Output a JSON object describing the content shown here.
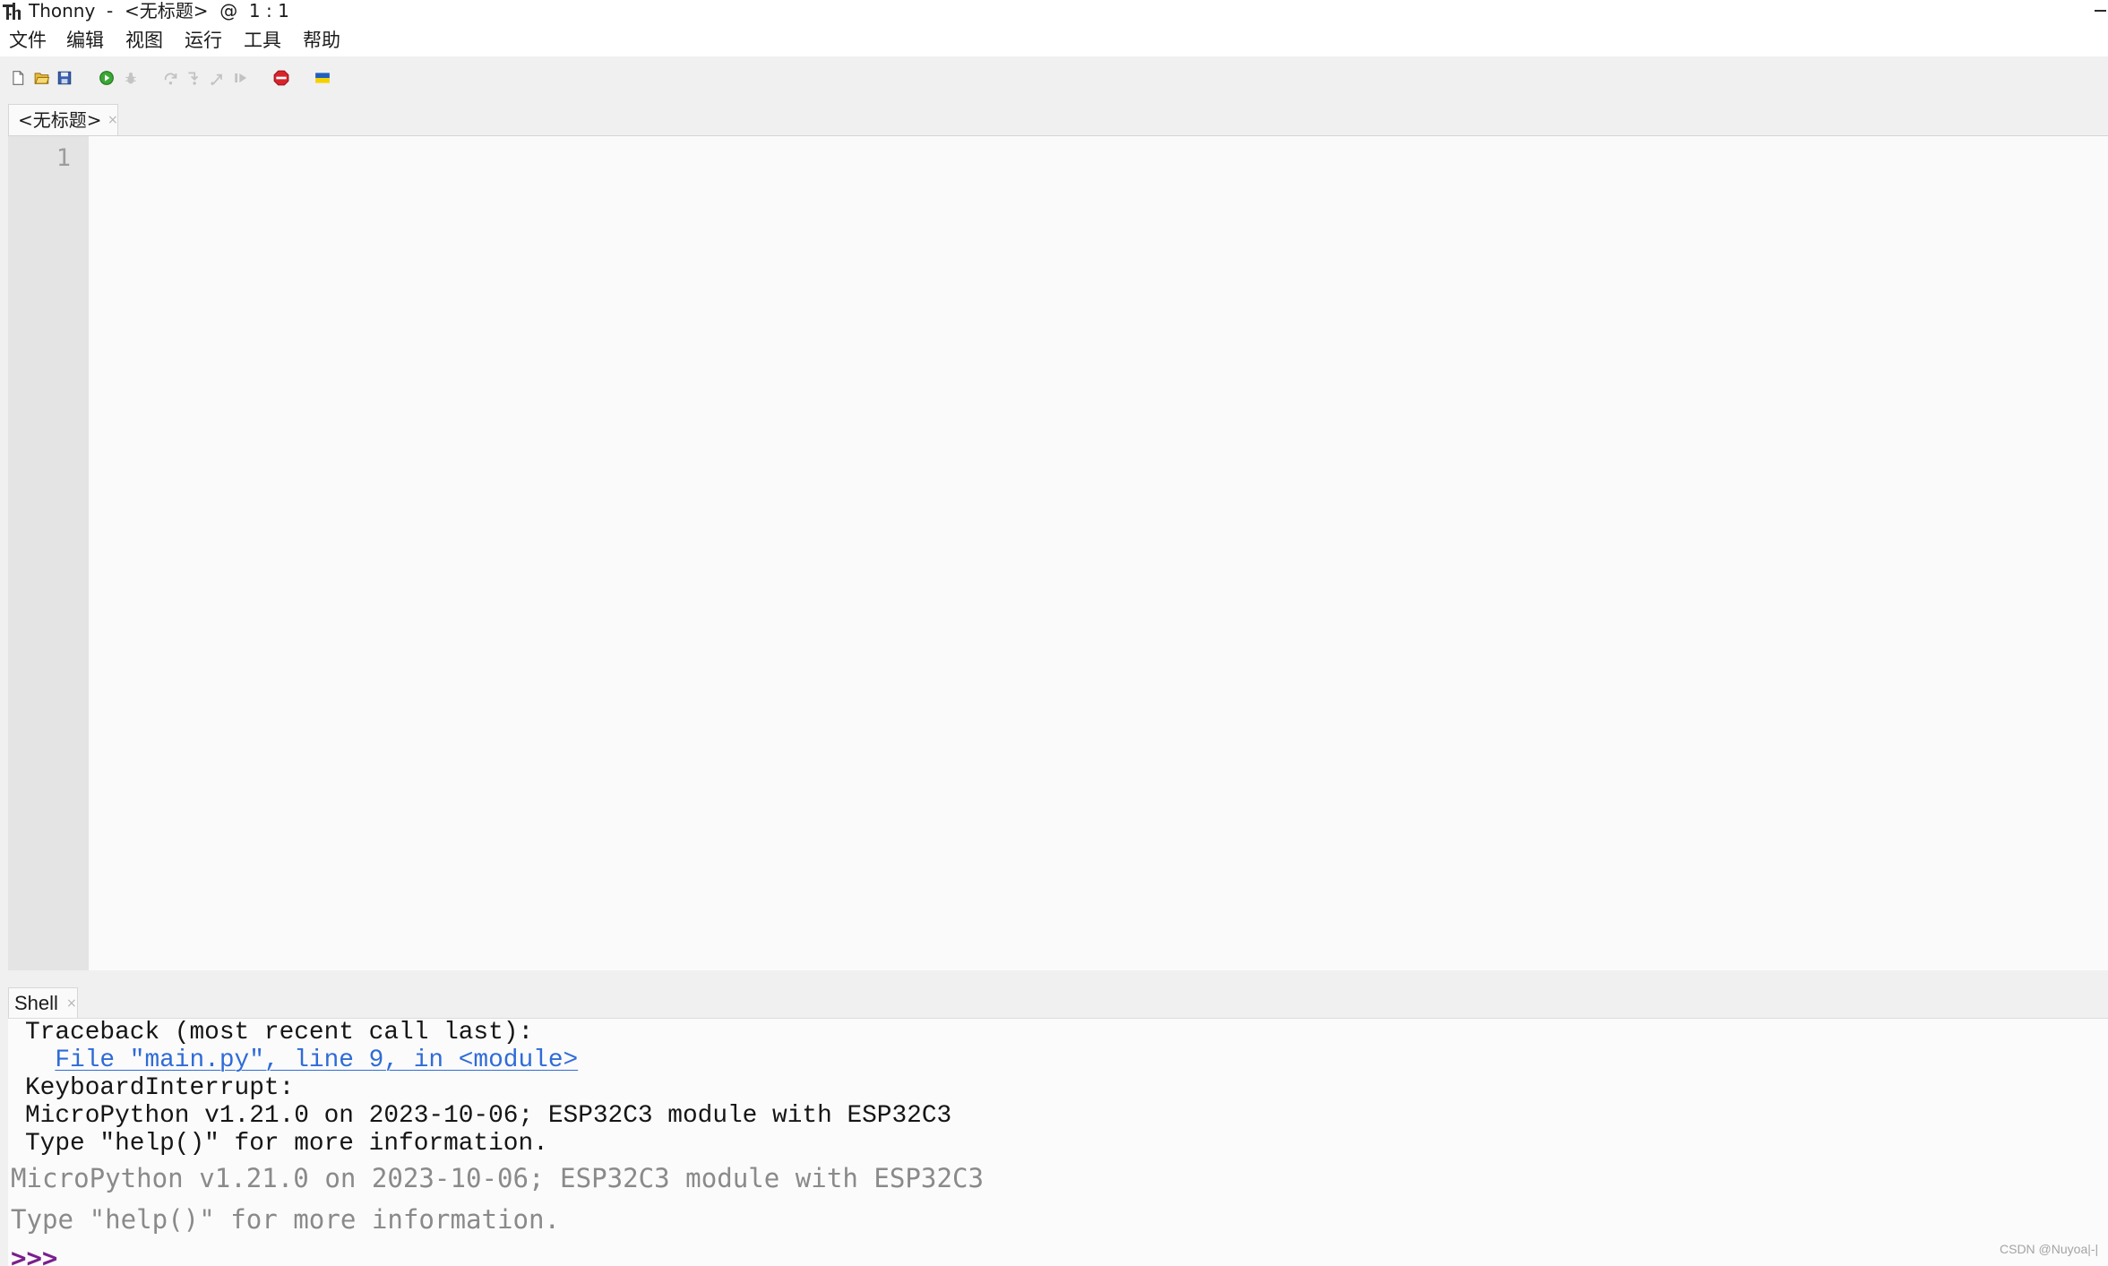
{
  "window": {
    "title": "Thonny  -  <无标题>  @  1 : 1",
    "app_icon": "thonny-logo-icon",
    "minimize_icon": "minimize-icon"
  },
  "menu": {
    "items": [
      {
        "label": "文件"
      },
      {
        "label": "编辑"
      },
      {
        "label": "视图"
      },
      {
        "label": "运行"
      },
      {
        "label": "工具"
      },
      {
        "label": "帮助"
      }
    ]
  },
  "toolbar": {
    "buttons": [
      {
        "icon": "new-file-icon",
        "enabled": true
      },
      {
        "icon": "open-file-icon",
        "enabled": true
      },
      {
        "icon": "save-file-icon",
        "enabled": true
      },
      {
        "icon": "run-script-icon",
        "enabled": true
      },
      {
        "icon": "debug-script-icon",
        "enabled": false
      },
      {
        "icon": "step-over-icon",
        "enabled": false
      },
      {
        "icon": "step-into-icon",
        "enabled": false
      },
      {
        "icon": "step-out-icon",
        "enabled": false
      },
      {
        "icon": "resume-icon",
        "enabled": false
      },
      {
        "icon": "stop-icon",
        "enabled": true
      },
      {
        "icon": "ukraine-flag-icon",
        "enabled": true
      }
    ]
  },
  "editor": {
    "tabs": [
      {
        "label": "<无标题>",
        "close": "×",
        "active": true
      }
    ],
    "line_numbers": [
      "1"
    ],
    "code": ""
  },
  "shell": {
    "tab": {
      "label": "Shell",
      "close": "×"
    },
    "output": [
      {
        "text": "Traceback (most recent call last):",
        "kind": "error"
      },
      {
        "text": "File \"main.py\", line 9, in <module>",
        "kind": "link"
      },
      {
        "text": "KeyboardInterrupt:",
        "kind": "error"
      },
      {
        "text": "MicroPython v1.21.0 on 2023-10-06; ESP32C3 module with ESP32C3",
        "kind": "output"
      },
      {
        "text": "Type \"help()\" for more information.",
        "kind": "output"
      }
    ],
    "welcome": [
      "MicroPython v1.21.0 on 2023-10-06; ESP32C3 module with ESP32C3",
      "Type \"help()\" for more information."
    ],
    "prompt": ">>>"
  },
  "watermark": "CSDN @Nuyoa|-|",
  "colors": {
    "link": "#2f6bd8",
    "prompt": "#7a1f8c",
    "welcome_text": "#8a8a8a",
    "run_icon": "#3aa835",
    "stop_icon": "#d8232a"
  }
}
